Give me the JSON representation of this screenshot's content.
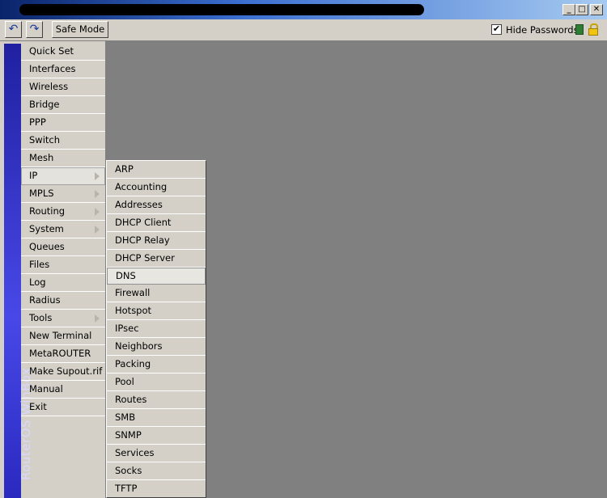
{
  "window": {
    "minimize_glyph": "_",
    "maximize_glyph": "□",
    "close_glyph": "✕"
  },
  "toolbar": {
    "undo_glyph": "↶",
    "redo_glyph": "↷",
    "safe_mode_label": "Safe Mode",
    "hide_passwords_checked": true,
    "hide_passwords_label": "Hide Passwords",
    "checkmark": "✔",
    "status_icon": "green-square-icon",
    "lock_icon": "lock-icon"
  },
  "sidebar": {
    "vertical_title": "RouterOS WinBox",
    "items": [
      {
        "label": "Quick Set",
        "submenu": false
      },
      {
        "label": "Interfaces",
        "submenu": false
      },
      {
        "label": "Wireless",
        "submenu": false
      },
      {
        "label": "Bridge",
        "submenu": false
      },
      {
        "label": "PPP",
        "submenu": false
      },
      {
        "label": "Switch",
        "submenu": false
      },
      {
        "label": "Mesh",
        "submenu": false
      },
      {
        "label": "IP",
        "submenu": true,
        "selected": true
      },
      {
        "label": "MPLS",
        "submenu": true
      },
      {
        "label": "Routing",
        "submenu": true
      },
      {
        "label": "System",
        "submenu": true
      },
      {
        "label": "Queues",
        "submenu": false
      },
      {
        "label": "Files",
        "submenu": false
      },
      {
        "label": "Log",
        "submenu": false
      },
      {
        "label": "Radius",
        "submenu": false
      },
      {
        "label": "Tools",
        "submenu": true
      },
      {
        "label": "New Terminal",
        "submenu": false
      },
      {
        "label": "MetaROUTER",
        "submenu": false
      },
      {
        "label": "Make Supout.rif",
        "submenu": false
      },
      {
        "label": "Manual",
        "submenu": false
      },
      {
        "label": "Exit",
        "submenu": false
      }
    ]
  },
  "ip_submenu": {
    "items": [
      "ARP",
      "Accounting",
      "Addresses",
      "DHCP Client",
      "DHCP Relay",
      "DHCP Server",
      "DNS",
      "Firewall",
      "Hotspot",
      "IPsec",
      "Neighbors",
      "Packing",
      "Pool",
      "Routes",
      "SMB",
      "SNMP",
      "Services",
      "Socks",
      "TFTP"
    ],
    "highlighted": "DNS"
  }
}
